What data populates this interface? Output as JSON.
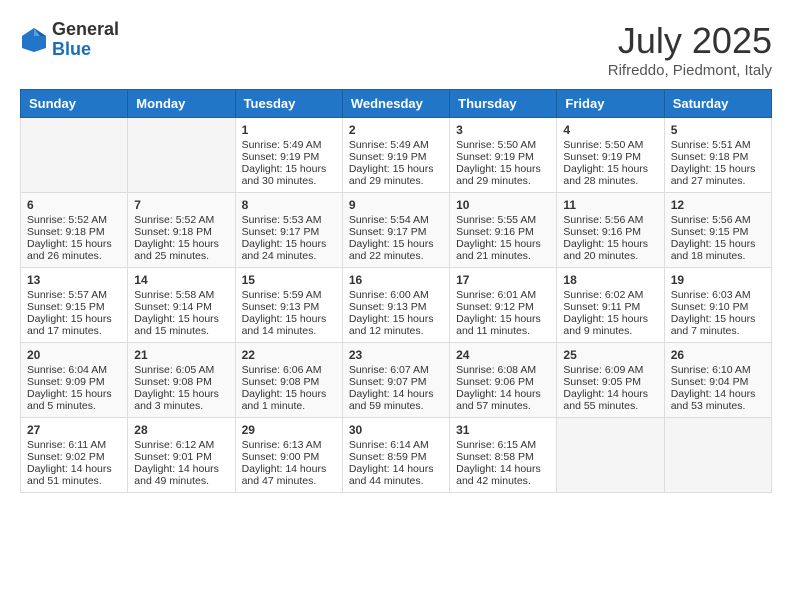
{
  "logo": {
    "general": "General",
    "blue": "Blue"
  },
  "title": {
    "month_year": "July 2025",
    "location": "Rifreddo, Piedmont, Italy"
  },
  "weekdays": [
    "Sunday",
    "Monday",
    "Tuesday",
    "Wednesday",
    "Thursday",
    "Friday",
    "Saturday"
  ],
  "weeks": [
    [
      {
        "day": "",
        "info": ""
      },
      {
        "day": "",
        "info": ""
      },
      {
        "day": "1",
        "info": "Sunrise: 5:49 AM\nSunset: 9:19 PM\nDaylight: 15 hours\nand 30 minutes."
      },
      {
        "day": "2",
        "info": "Sunrise: 5:49 AM\nSunset: 9:19 PM\nDaylight: 15 hours\nand 29 minutes."
      },
      {
        "day": "3",
        "info": "Sunrise: 5:50 AM\nSunset: 9:19 PM\nDaylight: 15 hours\nand 29 minutes."
      },
      {
        "day": "4",
        "info": "Sunrise: 5:50 AM\nSunset: 9:19 PM\nDaylight: 15 hours\nand 28 minutes."
      },
      {
        "day": "5",
        "info": "Sunrise: 5:51 AM\nSunset: 9:18 PM\nDaylight: 15 hours\nand 27 minutes."
      }
    ],
    [
      {
        "day": "6",
        "info": "Sunrise: 5:52 AM\nSunset: 9:18 PM\nDaylight: 15 hours\nand 26 minutes."
      },
      {
        "day": "7",
        "info": "Sunrise: 5:52 AM\nSunset: 9:18 PM\nDaylight: 15 hours\nand 25 minutes."
      },
      {
        "day": "8",
        "info": "Sunrise: 5:53 AM\nSunset: 9:17 PM\nDaylight: 15 hours\nand 24 minutes."
      },
      {
        "day": "9",
        "info": "Sunrise: 5:54 AM\nSunset: 9:17 PM\nDaylight: 15 hours\nand 22 minutes."
      },
      {
        "day": "10",
        "info": "Sunrise: 5:55 AM\nSunset: 9:16 PM\nDaylight: 15 hours\nand 21 minutes."
      },
      {
        "day": "11",
        "info": "Sunrise: 5:56 AM\nSunset: 9:16 PM\nDaylight: 15 hours\nand 20 minutes."
      },
      {
        "day": "12",
        "info": "Sunrise: 5:56 AM\nSunset: 9:15 PM\nDaylight: 15 hours\nand 18 minutes."
      }
    ],
    [
      {
        "day": "13",
        "info": "Sunrise: 5:57 AM\nSunset: 9:15 PM\nDaylight: 15 hours\nand 17 minutes."
      },
      {
        "day": "14",
        "info": "Sunrise: 5:58 AM\nSunset: 9:14 PM\nDaylight: 15 hours\nand 15 minutes."
      },
      {
        "day": "15",
        "info": "Sunrise: 5:59 AM\nSunset: 9:13 PM\nDaylight: 15 hours\nand 14 minutes."
      },
      {
        "day": "16",
        "info": "Sunrise: 6:00 AM\nSunset: 9:13 PM\nDaylight: 15 hours\nand 12 minutes."
      },
      {
        "day": "17",
        "info": "Sunrise: 6:01 AM\nSunset: 9:12 PM\nDaylight: 15 hours\nand 11 minutes."
      },
      {
        "day": "18",
        "info": "Sunrise: 6:02 AM\nSunset: 9:11 PM\nDaylight: 15 hours\nand 9 minutes."
      },
      {
        "day": "19",
        "info": "Sunrise: 6:03 AM\nSunset: 9:10 PM\nDaylight: 15 hours\nand 7 minutes."
      }
    ],
    [
      {
        "day": "20",
        "info": "Sunrise: 6:04 AM\nSunset: 9:09 PM\nDaylight: 15 hours\nand 5 minutes."
      },
      {
        "day": "21",
        "info": "Sunrise: 6:05 AM\nSunset: 9:08 PM\nDaylight: 15 hours\nand 3 minutes."
      },
      {
        "day": "22",
        "info": "Sunrise: 6:06 AM\nSunset: 9:08 PM\nDaylight: 15 hours\nand 1 minute."
      },
      {
        "day": "23",
        "info": "Sunrise: 6:07 AM\nSunset: 9:07 PM\nDaylight: 14 hours\nand 59 minutes."
      },
      {
        "day": "24",
        "info": "Sunrise: 6:08 AM\nSunset: 9:06 PM\nDaylight: 14 hours\nand 57 minutes."
      },
      {
        "day": "25",
        "info": "Sunrise: 6:09 AM\nSunset: 9:05 PM\nDaylight: 14 hours\nand 55 minutes."
      },
      {
        "day": "26",
        "info": "Sunrise: 6:10 AM\nSunset: 9:04 PM\nDaylight: 14 hours\nand 53 minutes."
      }
    ],
    [
      {
        "day": "27",
        "info": "Sunrise: 6:11 AM\nSunset: 9:02 PM\nDaylight: 14 hours\nand 51 minutes."
      },
      {
        "day": "28",
        "info": "Sunrise: 6:12 AM\nSunset: 9:01 PM\nDaylight: 14 hours\nand 49 minutes."
      },
      {
        "day": "29",
        "info": "Sunrise: 6:13 AM\nSunset: 9:00 PM\nDaylight: 14 hours\nand 47 minutes."
      },
      {
        "day": "30",
        "info": "Sunrise: 6:14 AM\nSunset: 8:59 PM\nDaylight: 14 hours\nand 44 minutes."
      },
      {
        "day": "31",
        "info": "Sunrise: 6:15 AM\nSunset: 8:58 PM\nDaylight: 14 hours\nand 42 minutes."
      },
      {
        "day": "",
        "info": ""
      },
      {
        "day": "",
        "info": ""
      }
    ]
  ]
}
